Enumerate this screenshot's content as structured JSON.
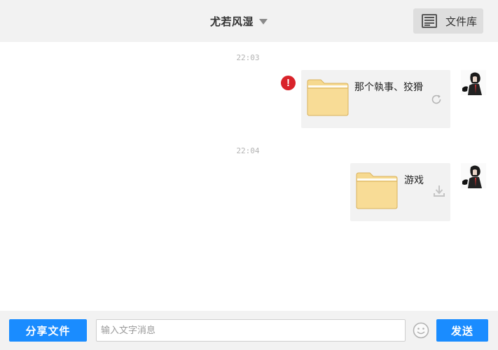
{
  "header": {
    "title": "尤若风湿",
    "file_library_label": "文件库"
  },
  "messages": [
    {
      "timestamp": "22:03",
      "file_name": "那个執事、狡猾",
      "status": "failed",
      "action": "retry"
    },
    {
      "timestamp": "22:04",
      "file_name": "游戏",
      "status": "sent",
      "action": "download"
    }
  ],
  "footer": {
    "share_label": "分享文件",
    "input_placeholder": "输入文字消息",
    "input_value": "",
    "send_label": "发送"
  },
  "colors": {
    "accent": "#1a8cff",
    "error": "#d9232a",
    "bubble": "#f2f2f2",
    "folder": "#f6d98f"
  }
}
